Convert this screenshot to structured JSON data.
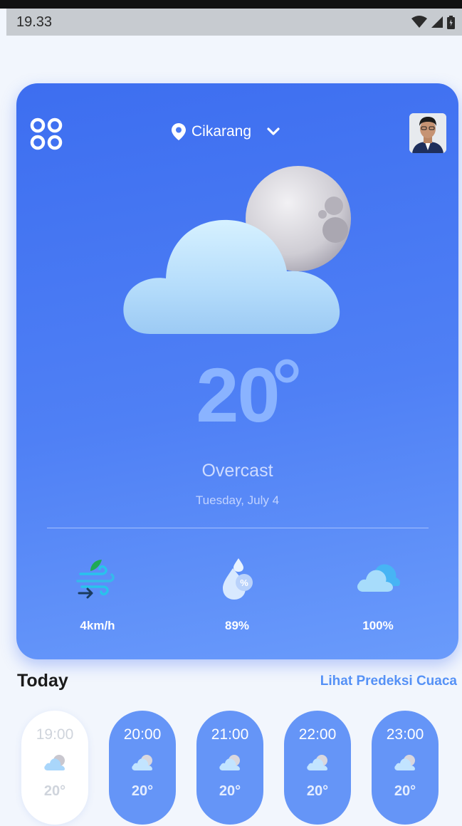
{
  "status_bar": {
    "time": "19.33"
  },
  "header": {
    "location": "Cikarang"
  },
  "current": {
    "temperature": "20",
    "condition": "Overcast",
    "date": "Tuesday, July 4"
  },
  "stats": {
    "wind": "4km/h",
    "humidity": "89%",
    "cloud": "100%"
  },
  "today": {
    "title": "Today",
    "link": "Lihat Predeksi Cuaca",
    "hours": [
      {
        "time": "19:00",
        "temp": "20°"
      },
      {
        "time": "20:00",
        "temp": "20°"
      },
      {
        "time": "21:00",
        "temp": "20°"
      },
      {
        "time": "22:00",
        "temp": "20°"
      },
      {
        "time": "23:00",
        "temp": "20°"
      }
    ]
  },
  "colors": {
    "card_start": "#3d6ef0",
    "card_end": "#6a9bfb",
    "hour_pill": "#6595f7",
    "link": "#5591f6"
  }
}
